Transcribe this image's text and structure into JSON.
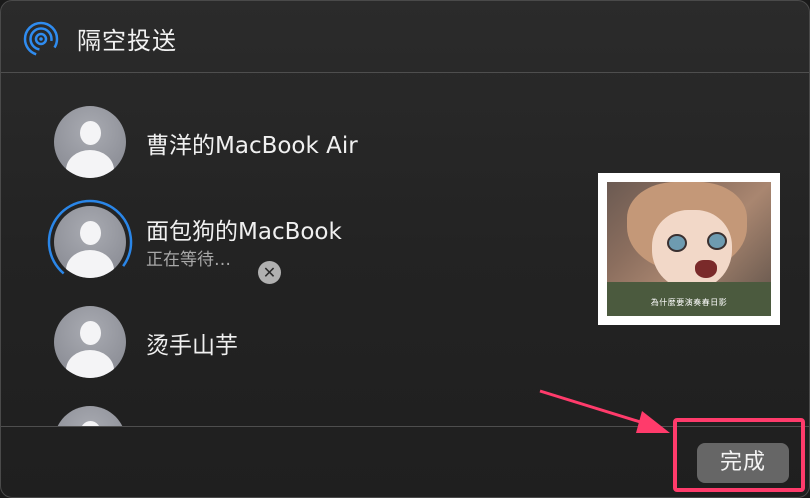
{
  "window": {
    "title": "隔空投送"
  },
  "devices": [
    {
      "name": "曹洋的MacBook Air",
      "status": ""
    },
    {
      "name": "面包狗的MacBook",
      "status": "正在等待…"
    },
    {
      "name": "烫手山芋",
      "status": ""
    },
    {
      "name": "",
      "status": ""
    }
  ],
  "preview": {
    "subtitle": "為什麼要演奏春日影"
  },
  "footer": {
    "done_label": "完成"
  },
  "icons": {
    "airdrop": "airdrop-icon",
    "avatar": "person-avatar-icon",
    "cancel": "close-icon"
  },
  "colors": {
    "airdrop_blue": "#2f8cf0",
    "progress_blue": "#2a86e8",
    "annotation_pink": "#ff3b6b"
  }
}
